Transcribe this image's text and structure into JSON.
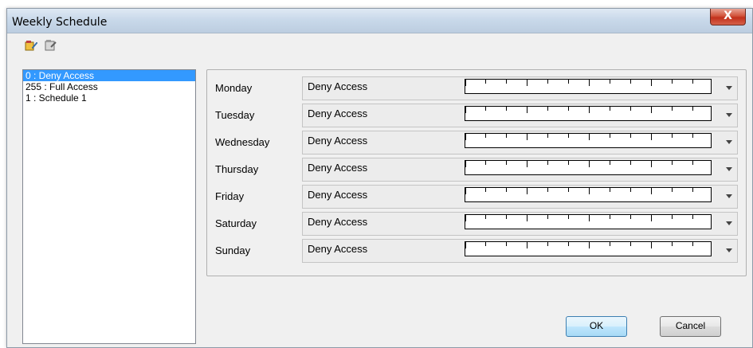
{
  "window": {
    "title": "Weekly Schedule",
    "close_glyph": "X"
  },
  "toolbar": {
    "icons": [
      "edit-schedule-icon",
      "delete-schedule-icon"
    ]
  },
  "schedules": [
    {
      "label": "0 : Deny Access",
      "selected": true
    },
    {
      "label": "255 : Full Access",
      "selected": false
    },
    {
      "label": "1 : Schedule 1",
      "selected": false
    }
  ],
  "days": [
    {
      "name": "Monday",
      "schedule": "Deny Access"
    },
    {
      "name": "Tuesday",
      "schedule": "Deny Access"
    },
    {
      "name": "Wednesday",
      "schedule": "Deny Access"
    },
    {
      "name": "Thursday",
      "schedule": "Deny Access"
    },
    {
      "name": "Friday",
      "schedule": "Deny Access"
    },
    {
      "name": "Saturday",
      "schedule": "Deny Access"
    },
    {
      "name": "Sunday",
      "schedule": "Deny Access"
    }
  ],
  "buttons": {
    "ok": "OK",
    "cancel": "Cancel"
  },
  "colors": {
    "selection": "#3399ff",
    "ok_border": "#3c7fb1",
    "close": "#c2301b"
  }
}
